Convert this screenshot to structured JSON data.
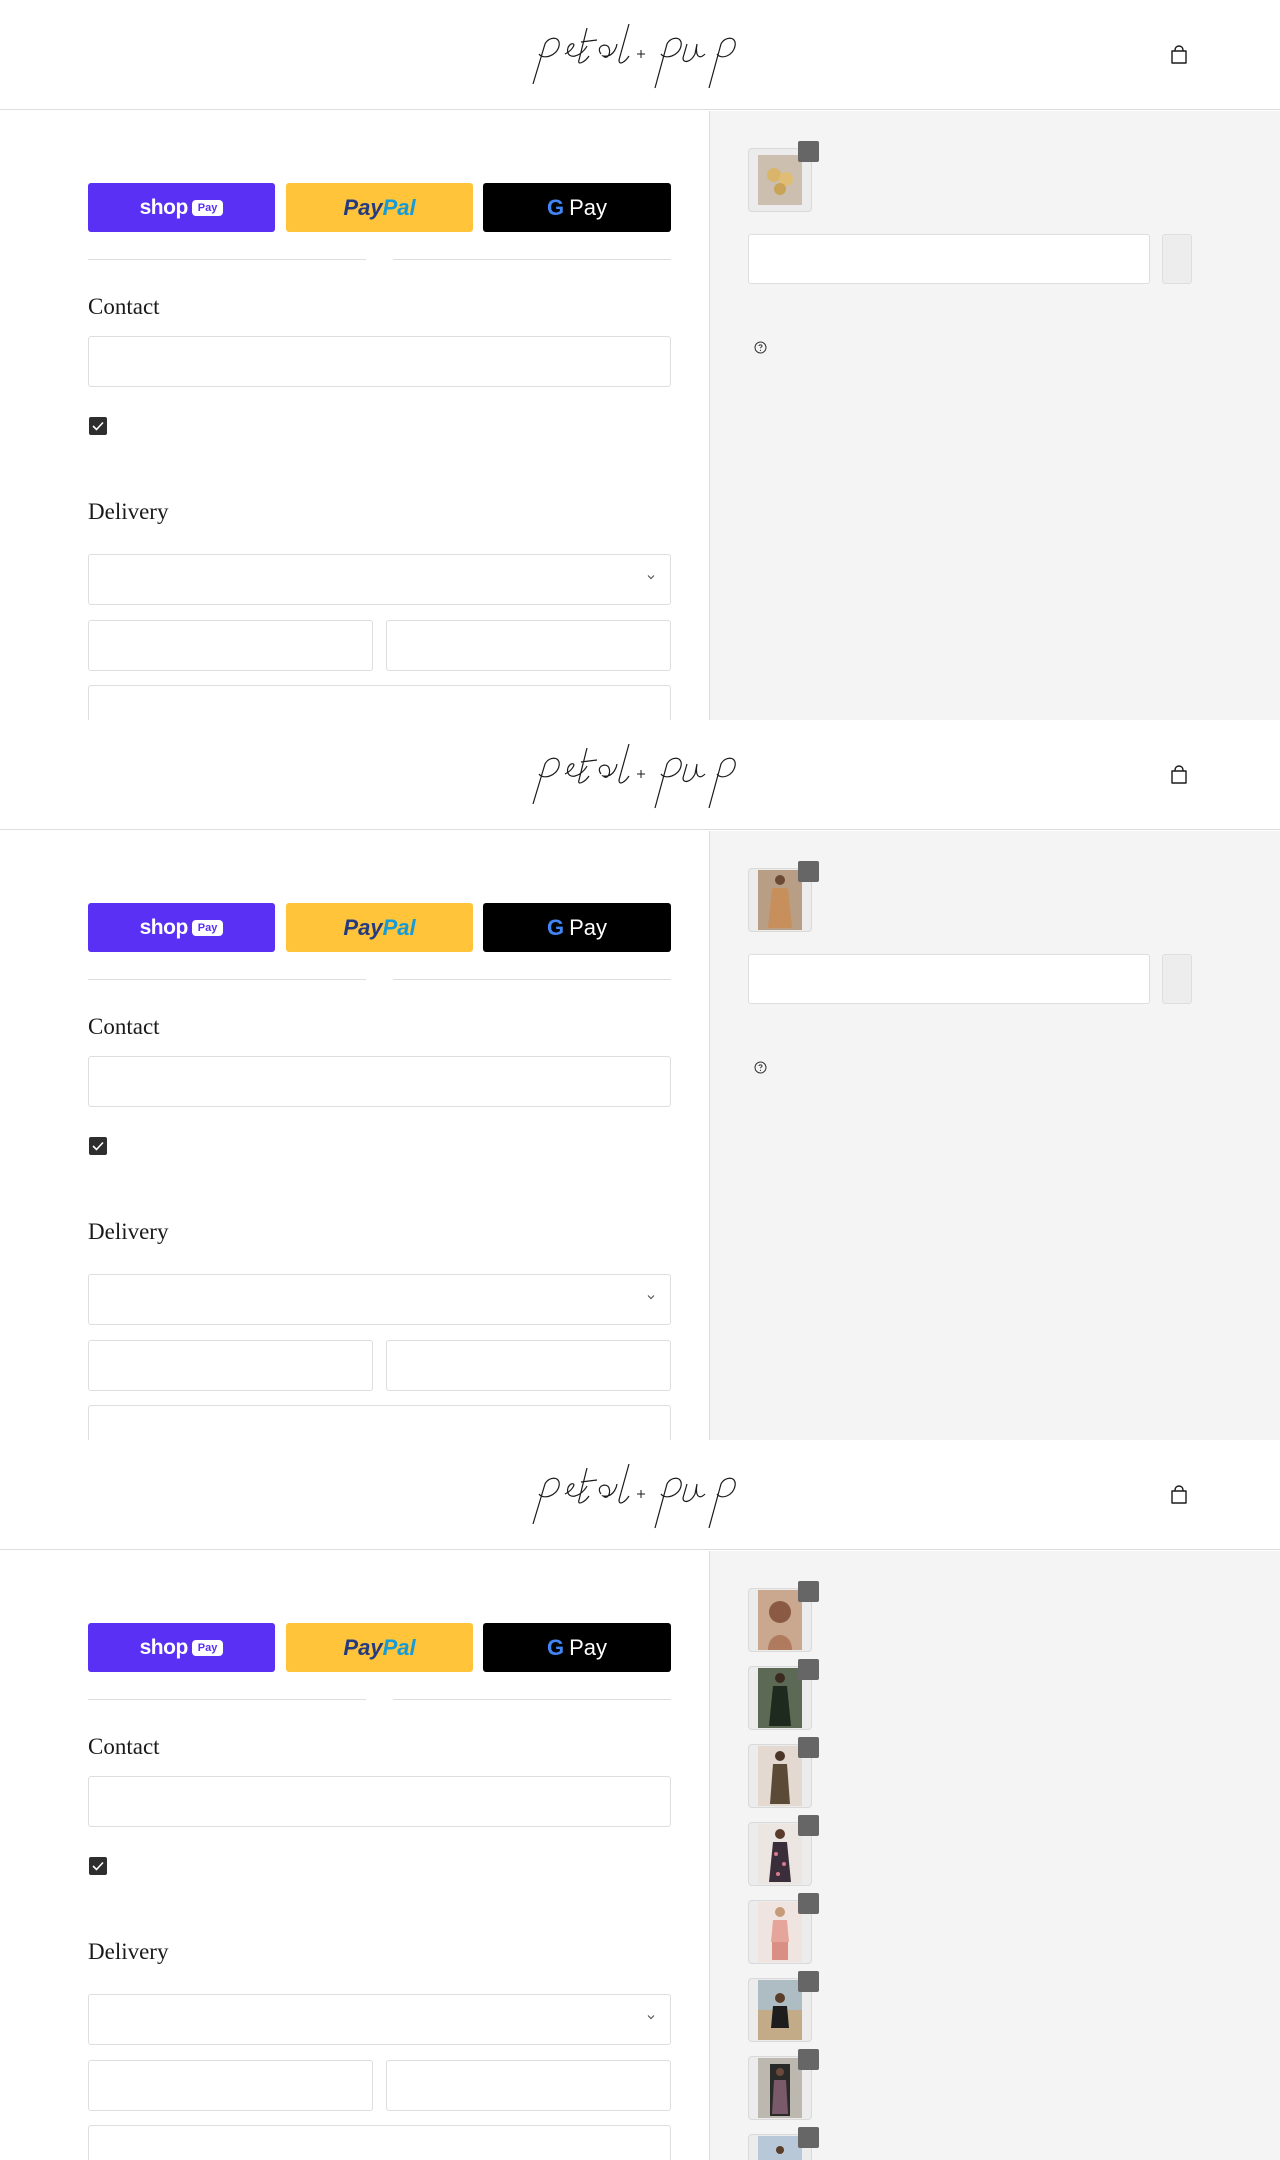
{
  "store": {
    "logo_text": "petal + pup",
    "cart_icon": "shopping-bag-icon"
  },
  "checkout": {
    "express": {
      "shop_pay": {
        "shop": "shop",
        "pay": "Pay"
      },
      "paypal": {
        "part1": "Pay",
        "part2": "Pal"
      },
      "gpay": {
        "g": "G",
        "pay": "Pay"
      }
    },
    "contact_heading": "Contact",
    "delivery_heading": "Delivery"
  },
  "summary": {
    "help_icon": "question-circle-icon",
    "product_images": [
      [
        "flower-earrings-image"
      ],
      [
        "tan-outfit-image"
      ],
      [
        "portrait-image",
        "black-dress-image",
        "olive-dress-image",
        "floral-dress-image",
        "pink-set-image",
        "beach-outfit-image",
        "floral-print-dress-image",
        "outdoor-outfit-image"
      ]
    ]
  },
  "colors": {
    "shop_pay": "#5a31f4",
    "paypal": "#ffc439",
    "gpay": "#000000",
    "sidebar_bg": "#f4f4f4",
    "qty_badge": "#666666",
    "checkbox": "#2e2e2e"
  }
}
